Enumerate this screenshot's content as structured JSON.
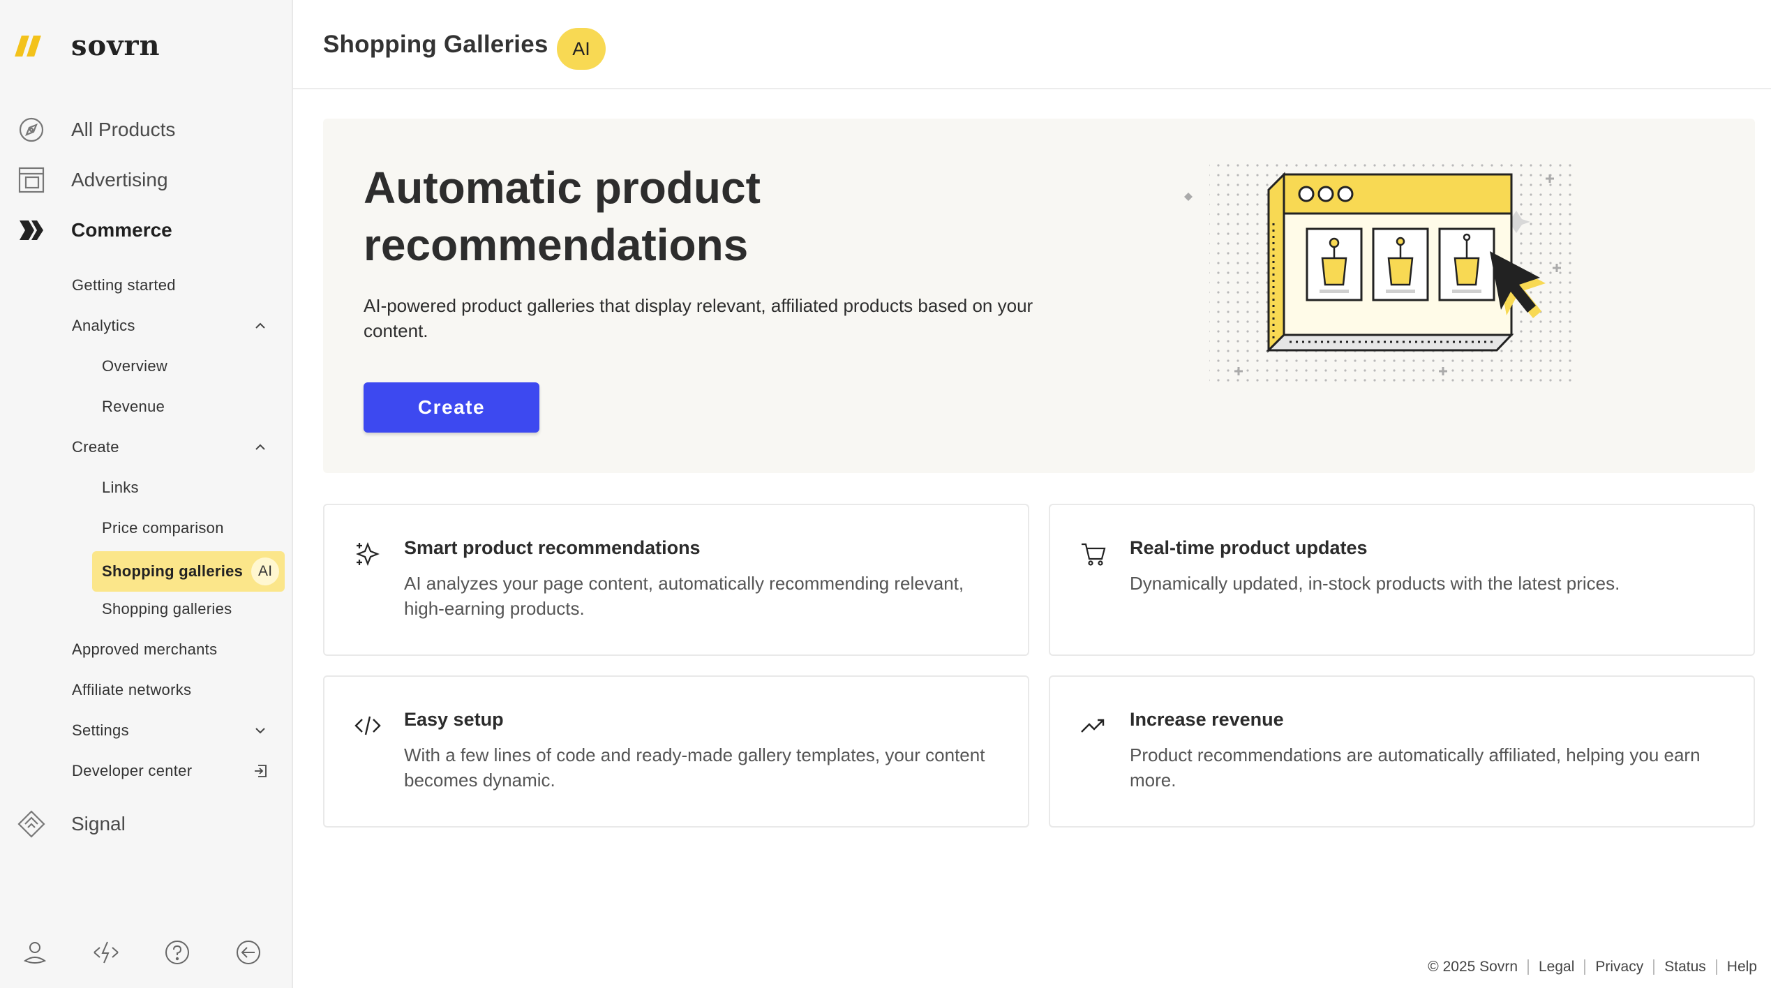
{
  "brand": {
    "name": "sovrn"
  },
  "sidebar": {
    "top_items": [
      {
        "label": "All Products",
        "icon": "compass-icon"
      },
      {
        "label": "Advertising",
        "icon": "layout-icon"
      },
      {
        "label": "Commerce",
        "icon": "commerce-chevrons-icon"
      }
    ],
    "sub_items": [
      {
        "label": "Getting started"
      },
      {
        "label": "Analytics"
      },
      {
        "label": "Overview"
      },
      {
        "label": "Revenue"
      },
      {
        "label": "Create"
      },
      {
        "label": "Links"
      },
      {
        "label": "Price comparison"
      },
      {
        "label": "Shopping galleries",
        "badge": "AI"
      },
      {
        "label": "Shopping galleries"
      },
      {
        "label": "Approved merchants"
      },
      {
        "label": "Affiliate networks"
      },
      {
        "label": "Settings"
      },
      {
        "label": "Developer center"
      }
    ],
    "signal": {
      "label": "Signal",
      "icon": "signal-diamond-icon"
    },
    "bottom_icons": [
      "user-icon",
      "activity-icon",
      "help-icon",
      "logout-icon"
    ]
  },
  "header": {
    "title": "Shopping Galleries",
    "badge": "AI"
  },
  "hero": {
    "title": "Automatic product recommendations",
    "description": "AI-powered product galleries that display relevant, affiliated products based on your content.",
    "button_label": "Create"
  },
  "features": [
    {
      "title": "Smart product recommendations",
      "description": "AI analyzes your page content, automatically recommending relevant, high-earning products.",
      "icon": "sparkle-icon"
    },
    {
      "title": "Real-time product updates",
      "description": "Dynamically updated, in-stock products with the latest prices.",
      "icon": "cart-icon"
    },
    {
      "title": "Easy setup",
      "description": "With a few lines of code and ready-made gallery templates, your content becomes dynamic.",
      "icon": "code-icon"
    },
    {
      "title": "Increase revenue",
      "description": "Product recommendations are automatically affiliated, helping you earn more.",
      "icon": "trending-up-icon"
    }
  ],
  "footer": {
    "copyright": "© 2025 Sovrn",
    "links": [
      "Legal",
      "Privacy",
      "Status",
      "Help"
    ]
  },
  "colors": {
    "accent": "#3d49f0",
    "brand_yellow": "#f8d953",
    "highlight": "#fbe68a"
  }
}
